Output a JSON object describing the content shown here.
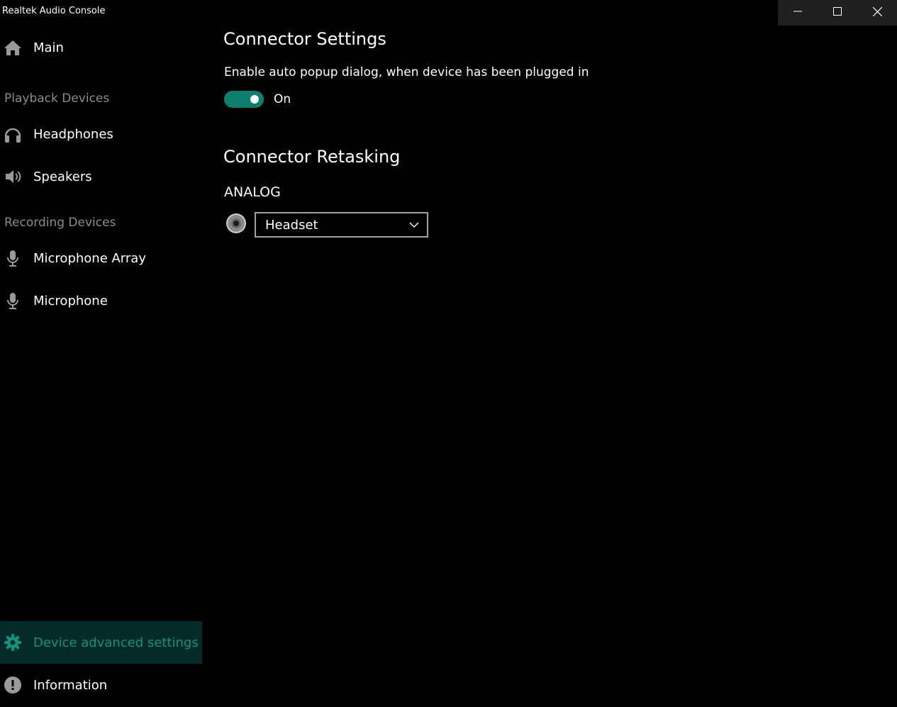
{
  "window": {
    "title": "Realtek Audio Console",
    "controls": {
      "minimize_icon": "minimize-icon",
      "maximize_icon": "maximize-icon",
      "close_icon": "close-icon"
    }
  },
  "sidebar": {
    "main": {
      "label": "Main",
      "icon": "home-icon"
    },
    "playback_header": "Playback Devices",
    "playback_items": [
      {
        "label": "Headphones",
        "icon": "headphones-icon"
      },
      {
        "label": "Speakers",
        "icon": "speaker-icon"
      }
    ],
    "recording_header": "Recording Devices",
    "recording_items": [
      {
        "label": "Microphone Array",
        "icon": "microphone-icon"
      },
      {
        "label": "Microphone",
        "icon": "microphone-icon"
      }
    ],
    "advanced": {
      "label": "Device advanced settings",
      "icon": "gear-icon",
      "active": true
    },
    "information": {
      "label": "Information",
      "icon": "info-icon"
    }
  },
  "content": {
    "connector_settings": {
      "title": "Connector Settings",
      "description": "Enable auto popup dialog, when device has been plugged in",
      "toggle_state": "On",
      "toggle_on": true
    },
    "connector_retasking": {
      "title": "Connector Retasking",
      "group_label": "ANALOG",
      "jack_icon": "audio-jack-icon",
      "selected_device": "Headset"
    }
  },
  "colors": {
    "accent": "#15917f",
    "toggle_on": "#0e7f6e",
    "active_bg": "#042b27",
    "section_header": "#8c8c8c",
    "background": "#000000"
  }
}
